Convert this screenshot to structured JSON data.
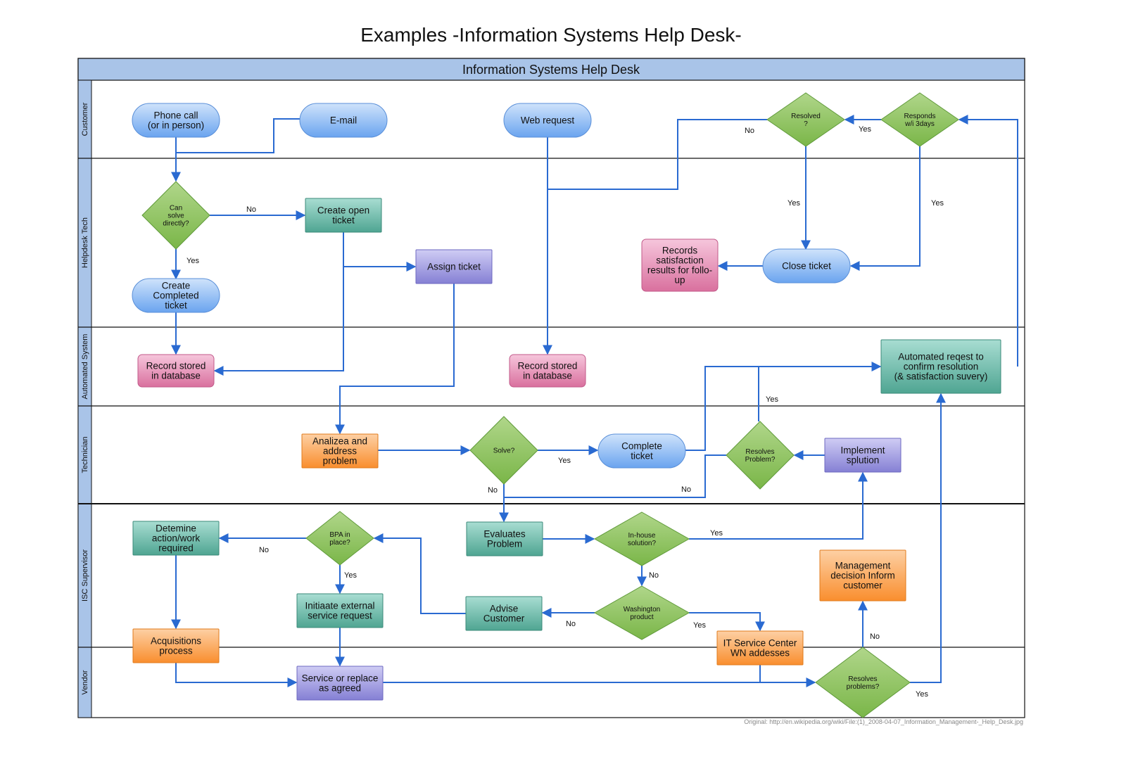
{
  "title": "Examples -Information Systems Help Desk-",
  "pool_title": "Information Systems Help Desk",
  "footer": "Original: http://en.wikipedia.org/wiki/File:(1)_2008-04-07_Information_Management-_Help_Desk.jpg",
  "colors": {
    "header_bg": "#a9c4e8",
    "edge": "#2a6ad1",
    "terminal": "#7fb2f0",
    "decision": "#8fc25b",
    "teal_process": "#6fbfad",
    "pink_data": "#e58ab5",
    "orange_process": "#fba65a",
    "purple_process": "#9a94dc"
  },
  "lanes": [
    {
      "id": "customer",
      "label": "Customer"
    },
    {
      "id": "helpdesk",
      "label": "Helpdesk Tech"
    },
    {
      "id": "automated",
      "label": "Automated System"
    },
    {
      "id": "technician",
      "label": "Technician"
    },
    {
      "id": "isc",
      "label": "ISC Supervisor"
    },
    {
      "id": "vendor",
      "label": "Vendor"
    }
  ],
  "nodes": [
    {
      "id": "phone",
      "type": "terminal",
      "lines": [
        "Phone call",
        "(or in person)"
      ]
    },
    {
      "id": "email",
      "type": "terminal",
      "lines": [
        "E-mail"
      ]
    },
    {
      "id": "web",
      "type": "terminal",
      "lines": [
        "Web request"
      ]
    },
    {
      "id": "resolved",
      "type": "decision",
      "lines": [
        "Resolved",
        "?"
      ]
    },
    {
      "id": "responds",
      "type": "decision",
      "lines": [
        "Responds",
        "w/i 3days"
      ]
    },
    {
      "id": "cansolve",
      "type": "decision",
      "lines": [
        "Can",
        "solve",
        "directly?"
      ]
    },
    {
      "id": "createopen",
      "type": "teal",
      "lines": [
        "Create open",
        "ticket"
      ]
    },
    {
      "id": "assign",
      "type": "purple",
      "lines": [
        "Assign ticket"
      ]
    },
    {
      "id": "createcompleted",
      "type": "terminal",
      "lines": [
        "Create",
        "Completed",
        "ticket"
      ]
    },
    {
      "id": "records",
      "type": "pink",
      "lines": [
        "Records",
        "satisfaction",
        "results for follo-",
        "up"
      ]
    },
    {
      "id": "close",
      "type": "terminal",
      "lines": [
        "Close ticket"
      ]
    },
    {
      "id": "db1",
      "type": "pink",
      "lines": [
        "Record stored",
        "in database"
      ]
    },
    {
      "id": "db2",
      "type": "pink",
      "lines": [
        "Record stored",
        "in database"
      ]
    },
    {
      "id": "autoreq",
      "type": "teal",
      "lines": [
        "Automated reqest to",
        "confirm resolution",
        "(& satisfaction suvery)"
      ]
    },
    {
      "id": "analyze",
      "type": "orange",
      "lines": [
        "Analizea and",
        "address",
        "problem"
      ]
    },
    {
      "id": "solve",
      "type": "decision",
      "lines": [
        "Solve?"
      ]
    },
    {
      "id": "complete",
      "type": "terminal",
      "lines": [
        "Complete",
        "ticket"
      ]
    },
    {
      "id": "resolvesproblem",
      "type": "decision",
      "lines": [
        "Resolves",
        "Problem?"
      ]
    },
    {
      "id": "implement",
      "type": "purple",
      "lines": [
        "Implement",
        "splution"
      ]
    },
    {
      "id": "determine",
      "type": "teal",
      "lines": [
        "Detemine",
        "action/work",
        "required"
      ]
    },
    {
      "id": "bpa",
      "type": "decision",
      "lines": [
        "BPA in",
        "place?"
      ]
    },
    {
      "id": "evaluates",
      "type": "teal",
      "lines": [
        "Evaluates",
        "Problem"
      ]
    },
    {
      "id": "inhouse",
      "type": "decision",
      "lines": [
        "In-house",
        "solution?"
      ]
    },
    {
      "id": "management",
      "type": "orange",
      "lines": [
        "Management",
        "decision Inform",
        "customer"
      ]
    },
    {
      "id": "initiate",
      "type": "teal",
      "lines": [
        "Initiaate external",
        "service request"
      ]
    },
    {
      "id": "advise",
      "type": "teal",
      "lines": [
        "Advise",
        "Customer"
      ]
    },
    {
      "id": "washington",
      "type": "decision",
      "lines": [
        "Washington",
        "product"
      ]
    },
    {
      "id": "itservice",
      "type": "orange",
      "lines": [
        "IT Service Center",
        "WN addesses"
      ]
    },
    {
      "id": "acquisitions",
      "type": "orange",
      "lines": [
        "Acquisitions",
        "process"
      ]
    },
    {
      "id": "servicereplace",
      "type": "purple",
      "lines": [
        "Service or replace",
        "as agreed"
      ]
    },
    {
      "id": "resolvesproblems",
      "type": "decision",
      "lines": [
        "Resolves",
        "problems?"
      ]
    }
  ],
  "edge_labels": [
    {
      "id": "l_resolved_no",
      "text": "No"
    },
    {
      "id": "l_responds_yes",
      "text": "Yes"
    },
    {
      "id": "l_resolved_yes",
      "text": "Yes"
    },
    {
      "id": "l_responds_yes2",
      "text": "Yes"
    },
    {
      "id": "l_cansolve_no",
      "text": "No"
    },
    {
      "id": "l_cansolve_yes",
      "text": "Yes"
    },
    {
      "id": "l_resolvesproblem_yes",
      "text": "Yes"
    },
    {
      "id": "l_solve_yes",
      "text": "Yes"
    },
    {
      "id": "l_solve_no",
      "text": "No"
    },
    {
      "id": "l_resolvesproblem_no",
      "text": "No"
    },
    {
      "id": "l_bpa_no",
      "text": "No"
    },
    {
      "id": "l_bpa_yes",
      "text": "Yes"
    },
    {
      "id": "l_inhouse_yes",
      "text": "Yes"
    },
    {
      "id": "l_inhouse_no",
      "text": "No"
    },
    {
      "id": "l_washington_no",
      "text": "No"
    },
    {
      "id": "l_washington_yes",
      "text": "Yes"
    },
    {
      "id": "l_resolvesproblems_no",
      "text": "No"
    },
    {
      "id": "l_resolvesproblems_yes",
      "text": "Yes"
    }
  ]
}
